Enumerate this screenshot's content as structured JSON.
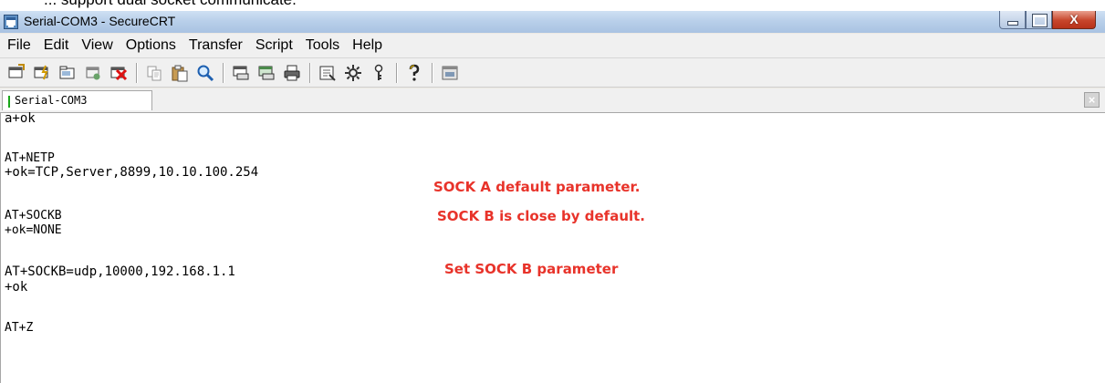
{
  "window": {
    "title": "Serial-COM3 - SecureCRT",
    "controls": {
      "minimize": "minimize",
      "maximize": "maximize",
      "close": "X"
    }
  },
  "menu": [
    "File",
    "Edit",
    "View",
    "Options",
    "Transfer",
    "Script",
    "Tools",
    "Help"
  ],
  "toolbar": {
    "icons": [
      "connect-icon",
      "quick-connect-icon",
      "connect-in-tab-icon",
      "reconnect-icon",
      "disconnect-icon",
      "copy-icon",
      "paste-icon",
      "find-icon",
      "print-setup-icon",
      "print-selection-icon",
      "print-icon",
      "session-options-icon",
      "global-options-icon",
      "keymap-icon",
      "help-icon",
      "sftp-icon"
    ]
  },
  "tab": {
    "label": "Serial-COM3"
  },
  "terminal": {
    "lines": [
      "a+ok",
      "AT+NETP",
      "+ok=TCP,Server,8899,10.10.100.254",
      "AT+SOCKB",
      "+ok=NONE",
      "AT+SOCKB=udp,10000,192.168.1.1",
      "+ok",
      "AT+Z"
    ]
  },
  "annotations": {
    "sock_a": "SOCK A default parameter.",
    "sock_b_close": "SOCK B is close by default.",
    "set_sock_b": "Set SOCK B parameter"
  },
  "colors": {
    "annotation": "#e8332a",
    "tab_marker": "#19a619",
    "close_button": "#c7452b"
  }
}
